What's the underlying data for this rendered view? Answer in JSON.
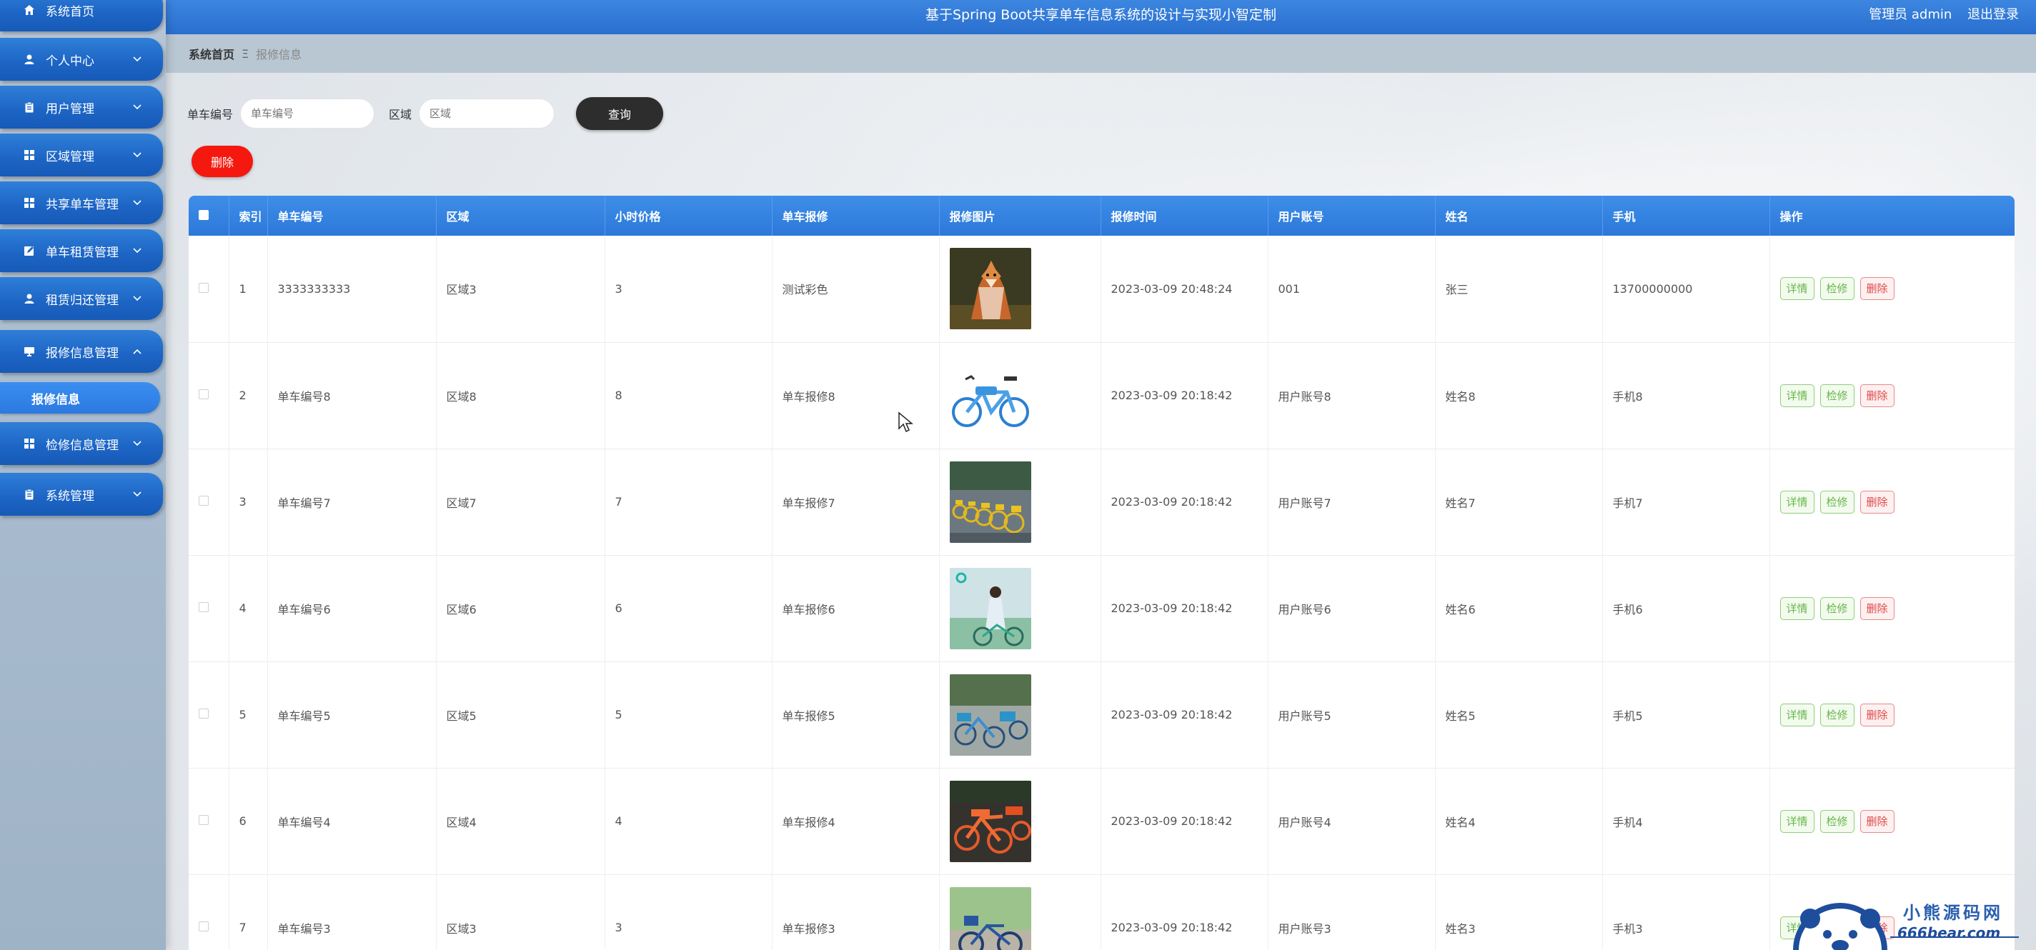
{
  "app": {
    "title": "基于Spring Boot共享单车信息系统的设计与实现小智定制",
    "user_role": "管理员 admin",
    "logout_label": "退出登录"
  },
  "sidebar": {
    "items": [
      {
        "label": "系统首页",
        "icon": "home-icon",
        "has_arrow": false
      },
      {
        "label": "个人中心",
        "icon": "user-icon",
        "has_arrow": true
      },
      {
        "label": "用户管理",
        "icon": "clipboard-icon",
        "has_arrow": true
      },
      {
        "label": "区域管理",
        "icon": "grid-icon",
        "has_arrow": true
      },
      {
        "label": "共享单车管理",
        "icon": "grid-icon",
        "has_arrow": true
      },
      {
        "label": "单车租赁管理",
        "icon": "edit-icon",
        "has_arrow": true
      },
      {
        "label": "租赁归还管理",
        "icon": "user-icon",
        "has_arrow": true
      },
      {
        "label": "报修信息管理",
        "icon": "monitor-icon",
        "has_arrow": true,
        "expanded": true
      },
      {
        "label": "检修信息管理",
        "icon": "grid-icon",
        "has_arrow": true
      },
      {
        "label": "系统管理",
        "icon": "clipboard-icon",
        "has_arrow": true
      }
    ],
    "sub_item": {
      "label": "报修信息"
    }
  },
  "breadcrumb": {
    "home": "系统首页",
    "separator": "Ξ",
    "current": "报修信息"
  },
  "search": {
    "bike_no_label": "单车编号",
    "bike_no_placeholder": "单车编号",
    "area_label": "区域",
    "area_placeholder": "区域",
    "query_label": "查询",
    "delete_label": "删除"
  },
  "table": {
    "headers": [
      "索引",
      "单车编号",
      "区域",
      "小时价格",
      "单车报修",
      "报修图片",
      "报修时间",
      "用户账号",
      "姓名",
      "手机",
      "操作"
    ],
    "ops": {
      "detail": "详情",
      "inspect": "检修",
      "delete": "删除"
    },
    "rows": [
      {
        "index": "1",
        "bike_no": "3333333333",
        "area": "区域3",
        "price": "3",
        "repair": "测试彩色",
        "image": "fox",
        "time": "2023-03-09 20:48:24",
        "account": "001",
        "name": "张三",
        "phone": "13700000000"
      },
      {
        "index": "2",
        "bike_no": "单车编号8",
        "area": "区域8",
        "price": "8",
        "repair": "单车报修8",
        "image": "blue-bike",
        "time": "2023-03-09 20:18:42",
        "account": "用户账号8",
        "name": "姓名8",
        "phone": "手机8"
      },
      {
        "index": "3",
        "bike_no": "单车编号7",
        "area": "区域7",
        "price": "7",
        "repair": "单车报修7",
        "image": "yellow-bikes-row",
        "time": "2023-03-09 20:18:42",
        "account": "用户账号7",
        "name": "姓名7",
        "phone": "手机7"
      },
      {
        "index": "4",
        "bike_no": "单车编号6",
        "area": "区域6",
        "price": "6",
        "repair": "单车报修6",
        "image": "girl-bike",
        "time": "2023-03-09 20:18:42",
        "account": "用户账号6",
        "name": "姓名6",
        "phone": "手机6"
      },
      {
        "index": "5",
        "bike_no": "单车编号5",
        "area": "区域5",
        "price": "5",
        "repair": "单车报修5",
        "image": "blue-bikes-street",
        "time": "2023-03-09 20:18:42",
        "account": "用户账号5",
        "name": "姓名5",
        "phone": "手机5"
      },
      {
        "index": "6",
        "bike_no": "单车编号4",
        "area": "区域4",
        "price": "4",
        "repair": "单车报修4",
        "image": "orange-bikes",
        "time": "2023-03-09 20:18:42",
        "account": "用户账号4",
        "name": "姓名4",
        "phone": "手机4"
      },
      {
        "index": "7",
        "bike_no": "单车编号3",
        "area": "区域3",
        "price": "3",
        "repair": "单车报修3",
        "image": "bike-trees",
        "time": "2023-03-09 20:18:42",
        "account": "用户账号3",
        "name": "姓名3",
        "phone": "手机3"
      }
    ]
  },
  "watermark": {
    "name": "小熊源码网",
    "url": "666bear.com"
  },
  "colors": {
    "primary": "#2a6fcf",
    "menu": "#1c64c4",
    "danger": "#f5180e",
    "success": "#67b64a"
  }
}
